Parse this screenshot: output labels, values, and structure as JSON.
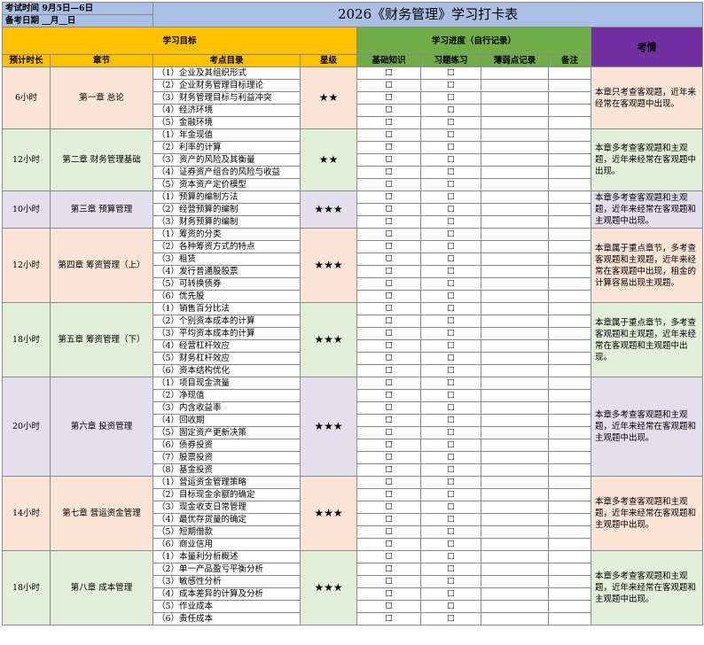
{
  "exam": {
    "time_label": "考试时间",
    "time_value": "9月5日—6日",
    "prep_label": "备考日期",
    "prep_value": "__月__日"
  },
  "title": "2026《财务管理》学习打卡表",
  "headers": {
    "goal": "学习目标",
    "progress": "学习进度（自行记录）",
    "status": "考情",
    "hours": "预计时长",
    "chapter": "章节",
    "topics": "考点目录",
    "level": "星级",
    "basic": "基础知识",
    "practice": "习题练习",
    "weak": "薄弱点记录",
    "remark": "备注"
  },
  "checkbox": "☐",
  "chapters": [
    {
      "hours": "6小时",
      "name": "第一章  总论",
      "stars": "★★",
      "color": "#fce4d6",
      "note": "本章只考查客观题，近年来经常在客观题中出现。",
      "topics": [
        "（1）企业及其组织形式",
        "（2）企业财务管理目标理论",
        "（3）财务管理目标与利益冲突",
        "（4）经济环境",
        "（5）金融环境"
      ]
    },
    {
      "hours": "12小时",
      "name": "第二章  财务管理基础",
      "stars": "★★",
      "color": "#e2efda",
      "note": "本章多考查客观题和主观题，近年来经常在客观题中出现。",
      "topics": [
        "（1）年金现值",
        "（2）利率的计算",
        "（3）资产的风险及其衡量",
        "（4）证券资产组合的风险与收益",
        "（5）资本资产定价模型"
      ]
    },
    {
      "hours": "10小时",
      "name": "第三章  预算管理",
      "stars": "★★★",
      "color": "#e4dfec",
      "note": "本章多考查客观题和主观题，近年来经常在客观题和主观题中出现。",
      "topics": [
        "（1）预算的编制方法",
        "（2）经营预算的编制",
        "（3）财务预算的编制"
      ]
    },
    {
      "hours": "12小时",
      "name": "第四章  筹资管理（上）",
      "stars": "★★★",
      "color": "#fce4d6",
      "note": "本章属于重点章节，多考查客观题和主观题，近年来经常在客观题中出现，租金的计算容易出现主观题。",
      "topics": [
        "（1）筹资的分类",
        "（2）各种筹资方式的特点",
        "（3）租赁",
        "（4）发行普通股股票",
        "（5）可转换债券",
        "（6）优先股"
      ]
    },
    {
      "hours": "18小时",
      "name": "第五章  筹资管理（下）",
      "stars": "★★★",
      "color": "#e2efda",
      "note": "本章属于重点章节，多考查客观题和主观题，近年来经常在客观题和主观题中出现。",
      "topics": [
        "（1）销售百分比法",
        "（2）个别资本成本的计算",
        "（3）平均资本成本的计算",
        "（4）经营杠杆效应",
        "（5）财务杠杆效应",
        "（6）资本结构优化"
      ]
    },
    {
      "hours": "20小时",
      "name": "第六章  投资管理",
      "stars": "★★★",
      "color": "#e4dfec",
      "note": "本章多考查客观题和主观题，近年来经常在客观题和主观题中出现。",
      "topics": [
        "（1）项目现金流量",
        "（2）净现值",
        "（3）内含收益率",
        "（4）回收期",
        "（5）固定资产更新决策",
        "（6）债券投资",
        "（7）股票投资",
        "（8）基金投资"
      ]
    },
    {
      "hours": "14小时",
      "name": "第七章  营运资金管理",
      "stars": "★★★",
      "color": "#fce4d6",
      "note": "本章多考查客观题和主观题，近年来经常在客观题和主观题中出现。",
      "topics": [
        "（1）营运资金管理策略",
        "（2）目标现金余额的确定",
        "（3）现金收支日常管理",
        "（4）最优存货量的确定",
        "（5）短期借款",
        "（6）商业信用"
      ]
    },
    {
      "hours": "18小时",
      "name": "第八章  成本管理",
      "stars": "★★★",
      "color": "#e2efda",
      "note": "本章多考查客观题和主观题，近年来经常在客观题和主观题中出现。",
      "topics": [
        "（1）本量利分析概述",
        "（2）单一产品盈亏平衡分析",
        "（3）敏感性分析",
        "（4）成本差异的计算及分析",
        "（5）作业成本",
        "（6）责任成本"
      ]
    }
  ]
}
